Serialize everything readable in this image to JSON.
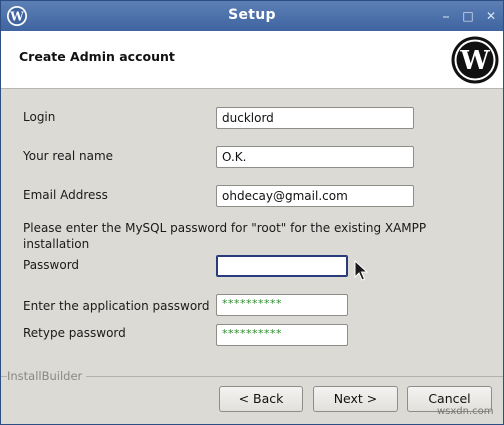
{
  "window": {
    "title": "Setup",
    "controls": {
      "minimize": "⎯",
      "maximize": "□",
      "close": "✕"
    }
  },
  "header": {
    "title": "Create Admin account"
  },
  "form": {
    "login": {
      "label": "Login",
      "value": "ducklord"
    },
    "real_name": {
      "label": "Your real name",
      "value": "O.K."
    },
    "email": {
      "label": "Email Address",
      "value": "ohdecay@gmail.com"
    },
    "mysql_note": "Please enter the MySQL password for \"root\" for the existing XAMPP installation",
    "password": {
      "label": "Password",
      "value": ""
    },
    "app_password": {
      "label": "Enter the application password",
      "value": "**********"
    },
    "retype_password": {
      "label": "Retype password",
      "value": "**********"
    }
  },
  "footer": {
    "brand": "InstallBuilder",
    "back_label": "< Back",
    "next_label": "Next >",
    "cancel_label": "Cancel"
  },
  "watermark": "wsxdn.com",
  "colors": {
    "titlebar": "#4a6fa8",
    "dialog_bg": "#dcdad5",
    "password_mask": "#2e8b2e"
  }
}
